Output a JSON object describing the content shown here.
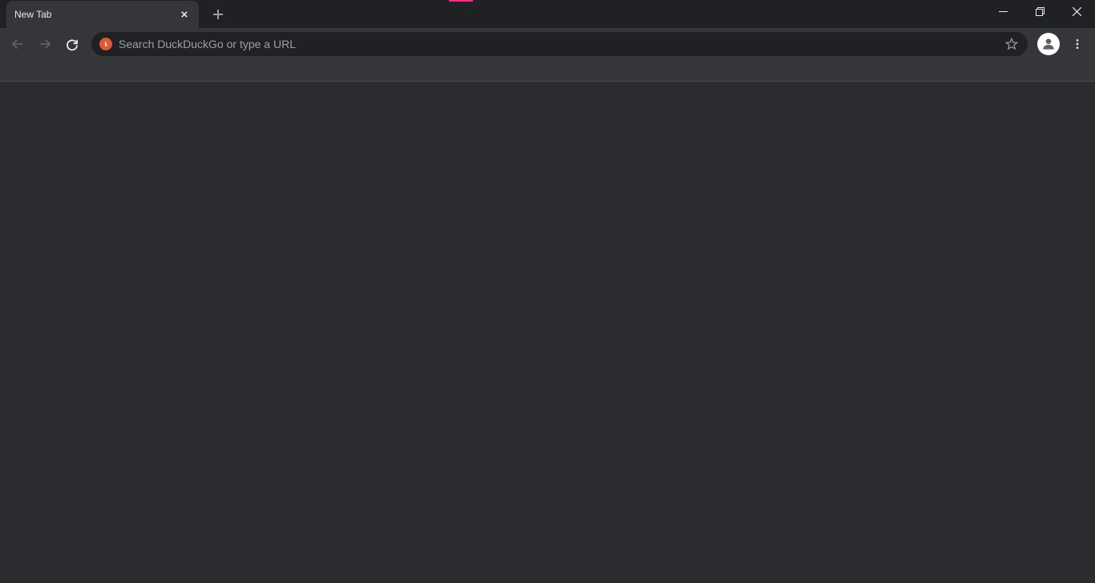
{
  "tab": {
    "title": "New Tab"
  },
  "omnibox": {
    "placeholder": "Search DuckDuckGo or type a URL",
    "value": ""
  },
  "colors": {
    "accent": "#ff2a8a",
    "search_engine_brand": "#de5833"
  }
}
